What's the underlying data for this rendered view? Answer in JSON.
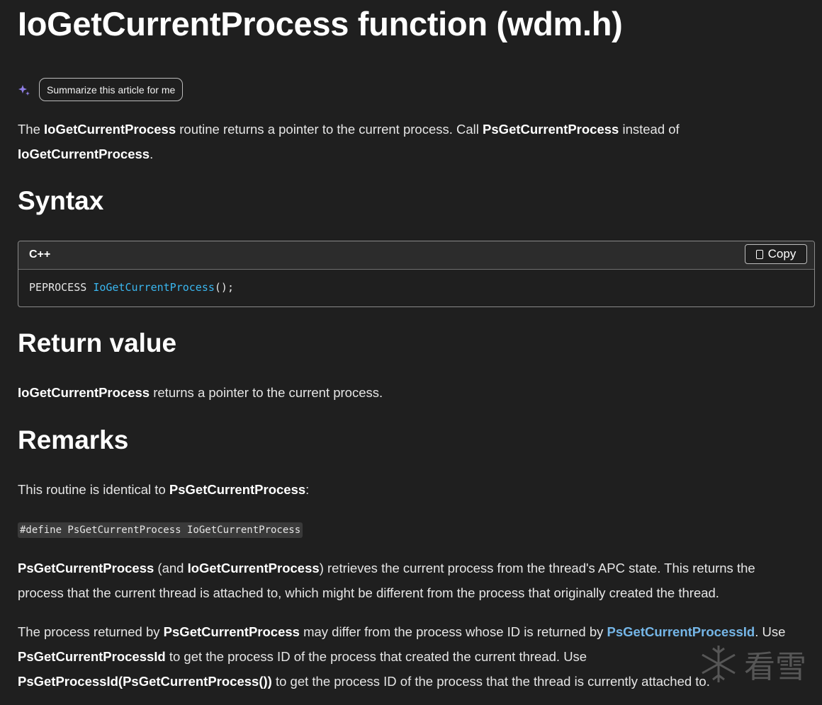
{
  "title": "IoGetCurrentProcess function (wdm.h)",
  "summarize_button": "Summarize this article for me",
  "intro": {
    "t1": "The ",
    "b1": "IoGetCurrentProcess",
    "t2": " routine returns a pointer to the current process. Call ",
    "b2": "PsGetCurrentProcess",
    "t3": " instead of",
    "b3": "IoGetCurrentProcess",
    "t4": "."
  },
  "syntax": {
    "heading": "Syntax",
    "language": "C++",
    "copy_label": "Copy",
    "code_type": "PEPROCESS ",
    "code_fn": "IoGetCurrentProcess",
    "code_rest": "();"
  },
  "return_value": {
    "heading": "Return value",
    "b1": "IoGetCurrentProcess",
    "t1": " returns a pointer to the current process."
  },
  "remarks": {
    "heading": "Remarks",
    "p1_t1": "This routine is identical to ",
    "p1_b1": "PsGetCurrentProcess",
    "p1_t2": ":",
    "define_code": "#define PsGetCurrentProcess IoGetCurrentProcess",
    "p2_b1": "PsGetCurrentProcess",
    "p2_t1": " (and ",
    "p2_b2": "IoGetCurrentProcess",
    "p2_t2": ") retrieves the current process from the thread's APC state. This returns the",
    "p2_t3": "process that the current thread is attached to, which might be different from the process that originally created the thread.",
    "p3_t1": "The process returned by ",
    "p3_b1": "PsGetCurrentProcess",
    "p3_t2": " may differ from the process whose ID is returned by ",
    "p3_link": "PsGetCurrentProcessId",
    "p3_t3": ". Use",
    "p3_b2": "PsGetCurrentProcessId",
    "p3_t4": " to get the process ID of the process that created the current thread. Use",
    "p3_b3": "PsGetProcessId(PsGetCurrentProcess())",
    "p3_t5": " to get the process ID of the process that the thread is currently attached to."
  },
  "watermark": {
    "text": "看雪",
    "icon": "snowflake-icon"
  },
  "colors": {
    "background": "#1f1f1f",
    "link": "#75b6e7",
    "code_function": "#3ab7f0",
    "sparkle": "#8f7ee6"
  }
}
